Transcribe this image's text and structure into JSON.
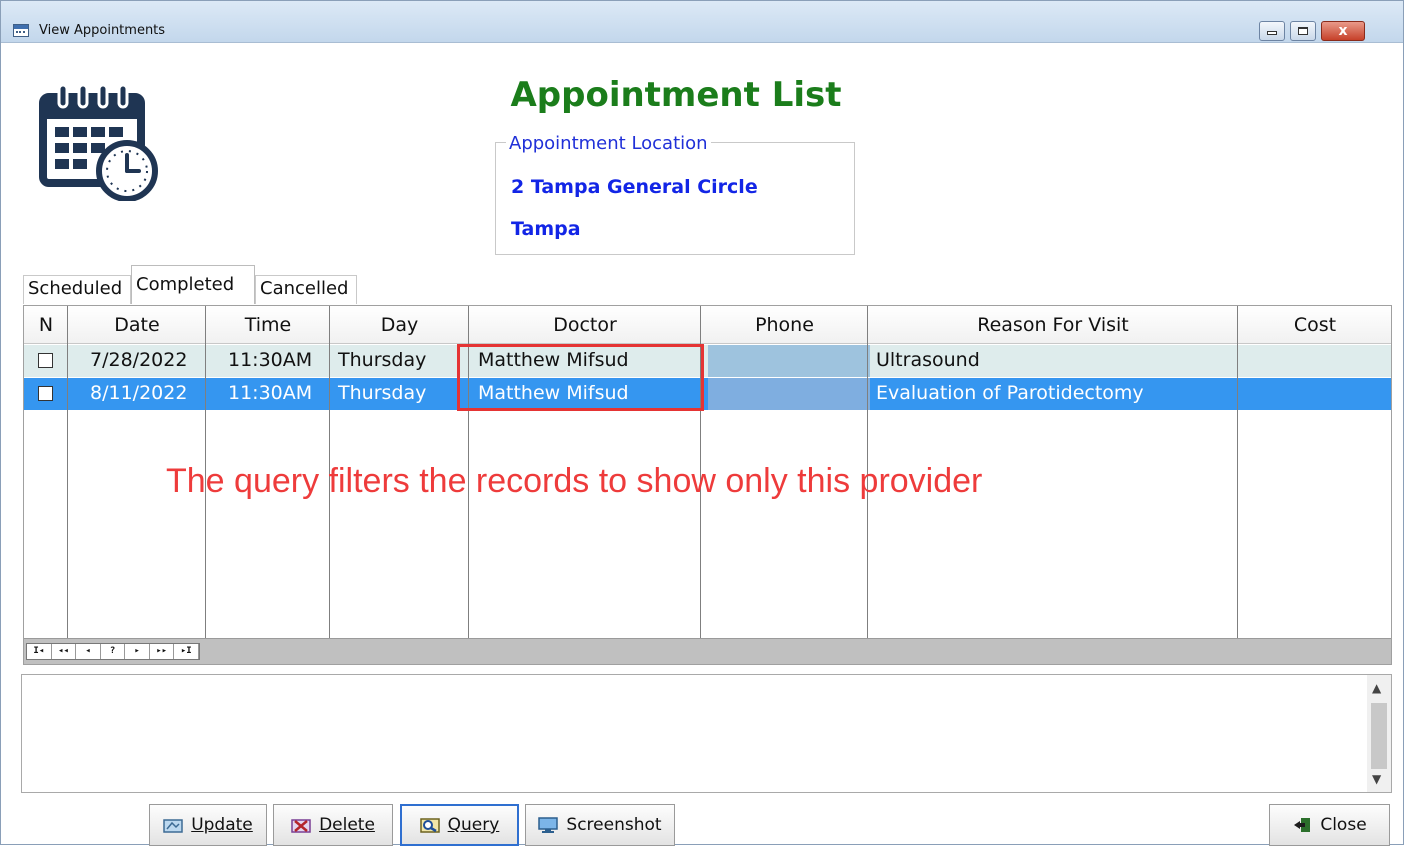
{
  "window": {
    "title": "View Appointments",
    "close_glyph": "x"
  },
  "header": {
    "heading": "Appointment List",
    "location_legend": "Appointment Location",
    "location_line1": "2 Tampa General Circle",
    "location_line2": "Tampa"
  },
  "tabs": [
    {
      "label": "Scheduled",
      "selected": false
    },
    {
      "label": "Completed",
      "selected": true
    },
    {
      "label": "Cancelled",
      "selected": false
    }
  ],
  "grid": {
    "columns": [
      "N",
      "Date",
      "Time",
      "Day",
      "Doctor",
      "Phone",
      "Reason For Visit",
      "Cost"
    ],
    "rows": [
      {
        "checked": false,
        "date": "7/28/2022",
        "time": "11:30AM",
        "day": "Thursday",
        "doctor": "Matthew Mifsud",
        "phone": "",
        "reason": "Ultrasound",
        "cost": "",
        "selected": false
      },
      {
        "checked": false,
        "date": "8/11/2022",
        "time": "11:30AM",
        "day": "Thursday",
        "doctor": "Matthew Mifsud",
        "phone": "",
        "reason": "Evaluation of Parotidectomy",
        "cost": "",
        "selected": true
      }
    ],
    "navigator": [
      "I◂",
      "◂◂",
      "◂",
      "?",
      "▸",
      "▸▸",
      "▸I"
    ]
  },
  "annotation": {
    "text": "The query filters the records to show only this provider",
    "color": "#ee3b3b"
  },
  "buttons": {
    "update": {
      "label": "Update",
      "icon": "update-icon"
    },
    "delete": {
      "label": "Delete",
      "icon": "delete-icon"
    },
    "query": {
      "label": "Query",
      "icon": "query-icon"
    },
    "screenshot": {
      "label": "Screenshot",
      "icon": "screenshot-icon"
    },
    "close": {
      "label": "Close",
      "icon": "exit-icon"
    }
  },
  "colors": {
    "heading": "#1b7d1b",
    "location_text": "#1225e6",
    "selected_row": "#3596f0",
    "alt_row": "#deecec"
  }
}
